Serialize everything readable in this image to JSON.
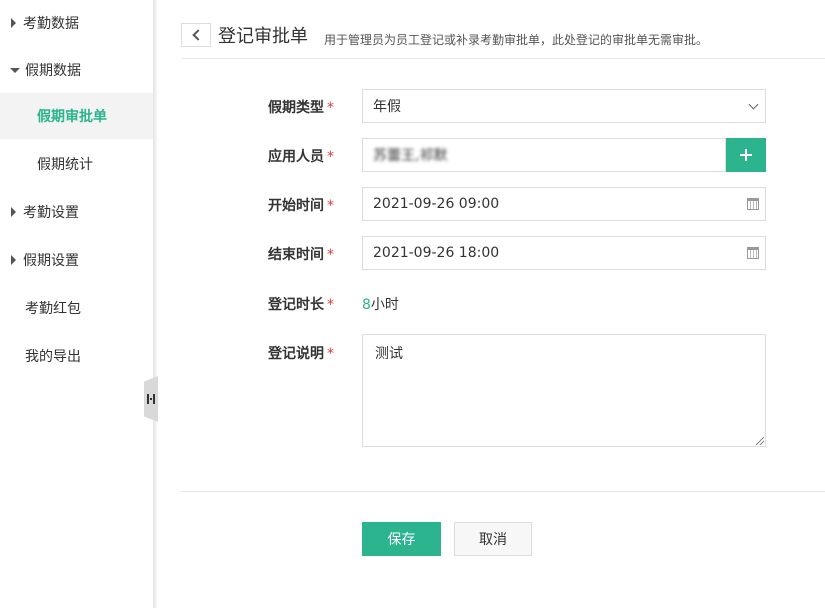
{
  "sidebar": {
    "items": [
      {
        "label": "考勤数据",
        "caret": "right"
      },
      {
        "label": "假期数据",
        "caret": "down"
      },
      {
        "label": "假期审批单",
        "sub": true,
        "active": true
      },
      {
        "label": "假期统计",
        "sub": true
      },
      {
        "label": "考勤设置",
        "caret": "right"
      },
      {
        "label": "假期设置",
        "caret": "right"
      },
      {
        "label": "考勤红包"
      },
      {
        "label": "我的导出"
      }
    ]
  },
  "header": {
    "title": "登记审批单",
    "description": "用于管理员为员工登记或补录考勤审批单，此处登记的审批单无需审批。"
  },
  "form": {
    "leave_type": {
      "label": "假期类型",
      "value": "年假"
    },
    "applicants": {
      "label": "应用人员",
      "value": "苏蕾王,祁默"
    },
    "start_time": {
      "label": "开始时间",
      "value": "2021-09-26 09:00"
    },
    "end_time": {
      "label": "结束时间",
      "value": "2021-09-26 18:00"
    },
    "duration": {
      "label": "登记时长",
      "value": "8",
      "unit": "小时"
    },
    "note": {
      "label": "登记说明",
      "value": "测试"
    },
    "required_mark": "*"
  },
  "actions": {
    "save_label": "保存",
    "cancel_label": "取消"
  },
  "colors": {
    "accent": "#2bb48e",
    "required": "#e03b3b"
  }
}
